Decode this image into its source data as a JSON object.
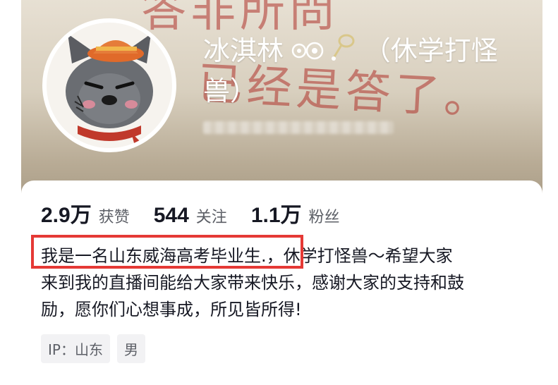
{
  "profile": {
    "nickname_main": "冰淇林",
    "nickname_rest": "（休学打怪兽）",
    "nickname_icons": [
      "eyes-icon",
      "badminton-icon"
    ],
    "banner_text": [
      "答非所問",
      "已经是答了。"
    ]
  },
  "stats": [
    {
      "value": "2.9万",
      "label": "获赞"
    },
    {
      "value": "544",
      "label": "关注"
    },
    {
      "value": "1.1万",
      "label": "粉丝"
    }
  ],
  "bio": {
    "line1_highlight": "我是一名山东威海高考毕业生.",
    "line1_rest": "，休学打怪兽～希望大家",
    "line2": "来到我的直播间能给大家带来快乐，感谢大家的支持和鼓",
    "line3": "励，愿你们心想事成，所见皆所得!"
  },
  "tags": [
    "IP：山东",
    "男"
  ],
  "colors": {
    "highlight_border": "#e53935",
    "scarf": "#c0392b",
    "hat": "#e06a2a"
  }
}
